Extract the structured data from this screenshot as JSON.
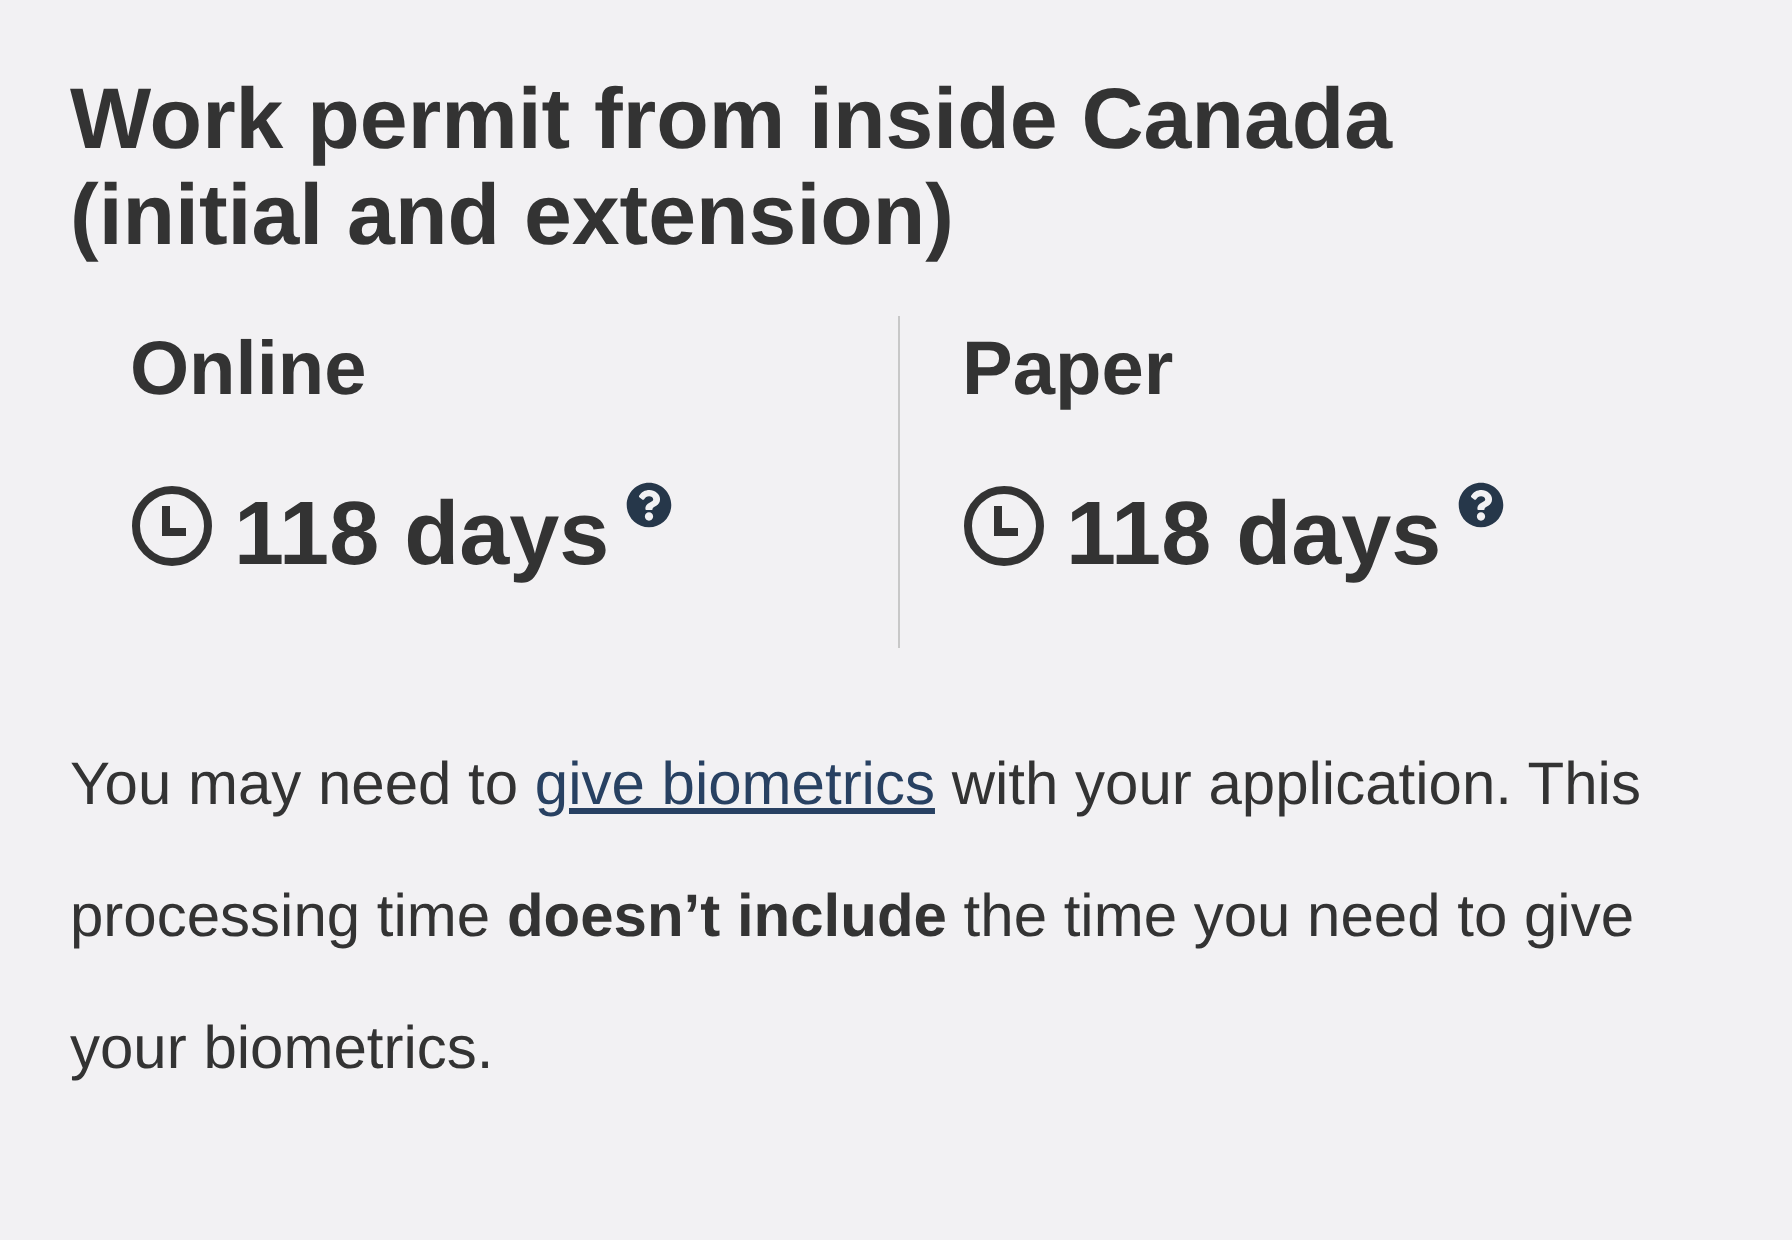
{
  "title": "Work permit from inside Canada (initial and extension)",
  "methods": [
    {
      "label": "Online",
      "time": "118 days"
    },
    {
      "label": "Paper",
      "time": "118 days"
    }
  ],
  "note": {
    "before": "You may need to",
    "link": "give biometrics",
    "after": "with your application. This processing time **doesn’t include** the time you need to give your biometrics."
  }
}
